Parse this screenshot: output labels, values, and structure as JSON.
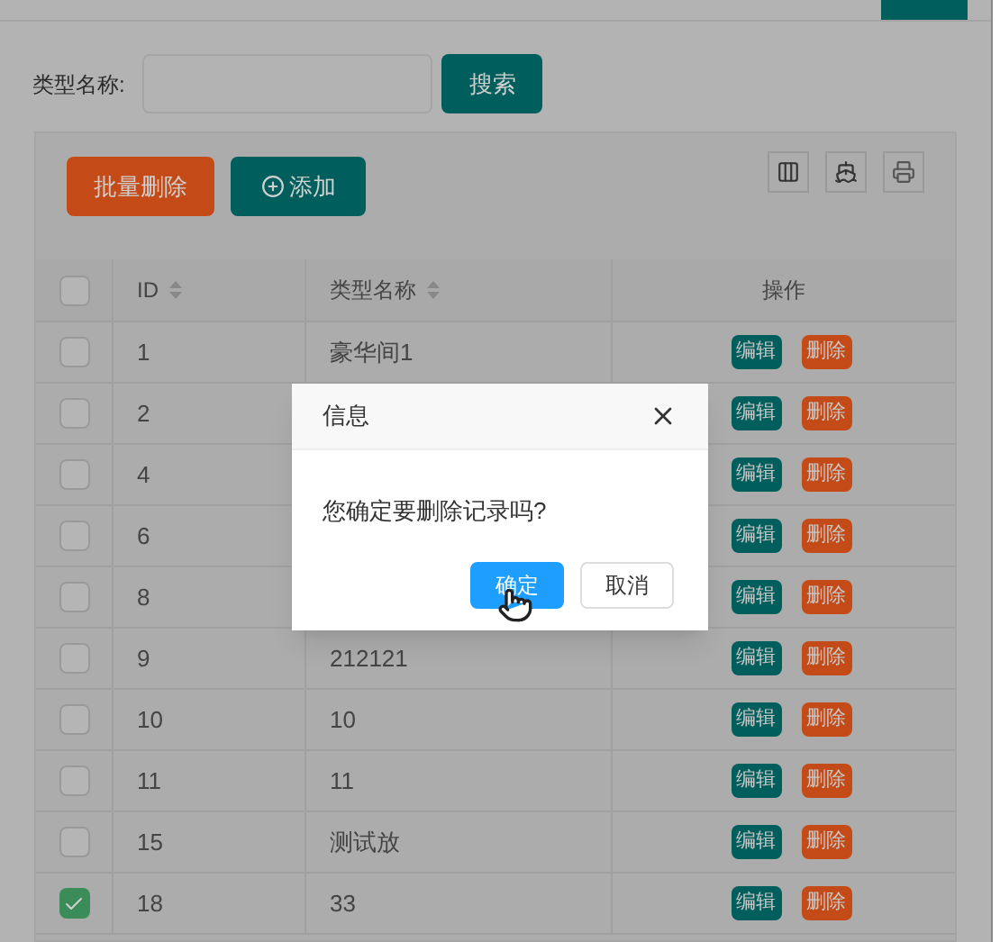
{
  "search": {
    "label": "类型名称:",
    "button": "搜索"
  },
  "toolbar": {
    "buttons": [
      {
        "kind": "danger",
        "label": "批量删除"
      },
      {
        "kind": "add",
        "label": "添加"
      }
    ]
  },
  "table": {
    "columns": [
      {
        "label": "ID",
        "sortable": true
      },
      {
        "label": "类型名称",
        "sortable": true
      },
      {
        "label": "操作",
        "sortable": false
      }
    ],
    "header_checked": false,
    "rows": [
      {
        "id": "1",
        "name": "豪华间1",
        "checked": false,
        "actions": [
          "编辑",
          "删除"
        ]
      },
      {
        "id": "2",
        "checked": false,
        "actions": [
          "编辑",
          "删除"
        ]
      },
      {
        "id": "4",
        "checked": false,
        "actions": [
          "编辑",
          "删除"
        ]
      },
      {
        "id": "6",
        "checked": false,
        "actions": [
          "编辑",
          "删除"
        ]
      },
      {
        "id": "8",
        "checked": false,
        "actions": [
          "编辑",
          "删除"
        ]
      },
      {
        "id": "9",
        "name": "212121",
        "checked": false,
        "actions": [
          "编辑",
          "删除"
        ]
      },
      {
        "id": "10",
        "name": "10",
        "checked": false,
        "actions": [
          "编辑",
          "删除"
        ]
      },
      {
        "id": "11",
        "name": "11",
        "checked": false,
        "actions": [
          "编辑",
          "删除"
        ]
      },
      {
        "id": "15",
        "name": "测试放",
        "checked": false,
        "actions": [
          "编辑",
          "删除"
        ]
      },
      {
        "id": "18",
        "name": "33",
        "checked": true,
        "actions": [
          "编辑",
          "删除"
        ]
      }
    ]
  },
  "dialog": {
    "title": "信息",
    "message": "您确定要删除记录吗?",
    "buttons": [
      {
        "kind": "primary",
        "label": "确定"
      },
      {
        "kind": "default",
        "label": "取消"
      }
    ]
  }
}
